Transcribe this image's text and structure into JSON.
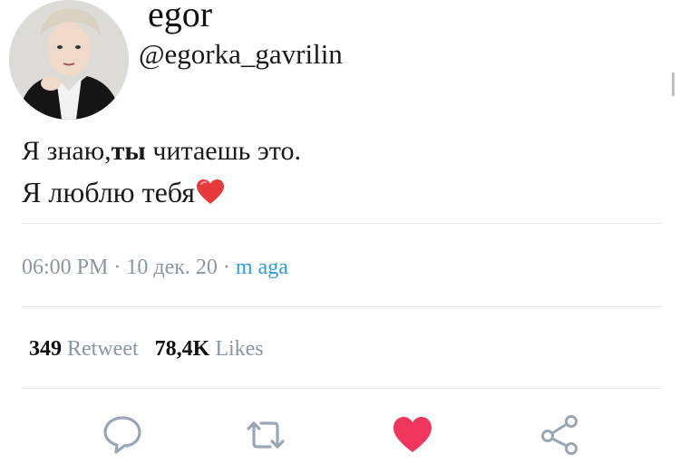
{
  "tweet": {
    "display_name": "egor",
    "handle": "@egorka_gavrilin",
    "text_line1_part1": "Я знаю,",
    "text_line1_bold": "ты",
    "text_line1_part2": " читаешь это.",
    "text_line2": "Я люблю тебя",
    "time": "06:00 PM",
    "date": "10 дек. 20",
    "source": "m aga",
    "separator": " · ",
    "retweet_count": "349",
    "retweet_label": "Retweet",
    "like_count": "78,4K",
    "like_label": "Likes"
  },
  "icons": {
    "inline_emoji": "red-heart-emoji",
    "actions": [
      "reply-icon",
      "retweet-icon",
      "like-icon",
      "share-icon"
    ]
  },
  "colors": {
    "like_active": "#f0365c",
    "link": "#2b9be6",
    "muted": "#8a97a3",
    "icon": "#9aa6b2"
  }
}
